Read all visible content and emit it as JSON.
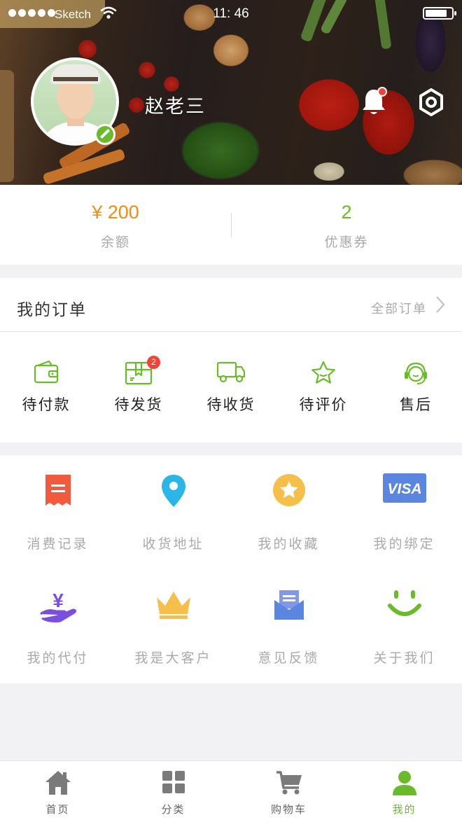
{
  "status_bar": {
    "carrier": "Sketch",
    "time": "11: 46"
  },
  "profile": {
    "username": "赵老三"
  },
  "balance": {
    "amount": "¥ 200",
    "amount_label": "余额",
    "coupons": "2",
    "coupons_label": "优惠券"
  },
  "orders": {
    "title": "我的订单",
    "all_label": "全部订单",
    "items": [
      {
        "label": "待付款",
        "icon": "wallet-icon"
      },
      {
        "label": "待发货",
        "icon": "package-icon",
        "badge": "2"
      },
      {
        "label": "待收货",
        "icon": "truck-icon"
      },
      {
        "label": "待评价",
        "icon": "star-icon"
      },
      {
        "label": "售后",
        "icon": "headset-icon"
      }
    ]
  },
  "services": {
    "items": [
      {
        "label": "消费记录",
        "icon": "receipt-icon"
      },
      {
        "label": "收货地址",
        "icon": "location-icon"
      },
      {
        "label": "我的收藏",
        "icon": "favorite-icon"
      },
      {
        "label": "我的绑定",
        "icon": "visa-icon",
        "icon_text": "VISA"
      },
      {
        "label": "我的代付",
        "icon": "yen-hand-icon",
        "icon_text": "¥"
      },
      {
        "label": "我是大客户",
        "icon": "crown-icon"
      },
      {
        "label": "意见反馈",
        "icon": "mail-icon"
      },
      {
        "label": "关于我们",
        "icon": "smile-icon"
      }
    ]
  },
  "tabbar": {
    "tabs": [
      {
        "label": "首页",
        "icon": "home-icon"
      },
      {
        "label": "分类",
        "icon": "grid-icon"
      },
      {
        "label": "购物车",
        "icon": "cart-icon"
      },
      {
        "label": "我的",
        "icon": "user-icon",
        "active": true
      }
    ]
  },
  "colors": {
    "accent": "#6abb2a",
    "balance": "#f08c14",
    "badge": "#f04438"
  }
}
